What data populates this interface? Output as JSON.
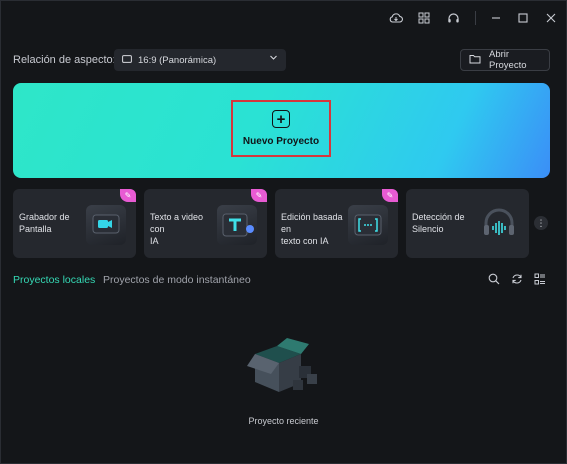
{
  "titlebar": {
    "icons": [
      "cloud-icon",
      "grid-icon",
      "headset-icon",
      "minimize-icon",
      "maximize-icon",
      "close-icon"
    ]
  },
  "aspect": {
    "label": "Relación de aspecto:",
    "selected": "16:9 (Panorámica)"
  },
  "open_project": {
    "label": "Abrir Proyecto"
  },
  "banner": {
    "new_project_label": "Nuevo Proyecto",
    "colors": {
      "start": "#2ee6c8",
      "end": "#3b8ef7"
    }
  },
  "tools": [
    {
      "line1": "Grabador de",
      "line2": "Pantalla",
      "icon": "screen-recorder-icon"
    },
    {
      "line1": "Texto a video con",
      "line2": "IA",
      "icon": "text-to-video-icon"
    },
    {
      "line1": "Edición basada en",
      "line2": "texto con IA",
      "icon": "text-edit-icon"
    },
    {
      "line1": "Detección de",
      "line2": "Silencio",
      "icon": "silence-detect-icon"
    }
  ],
  "tabs": {
    "local": "Proyectos locales",
    "instant": "Proyectos de modo instantáneo"
  },
  "empty": {
    "label": "Proyecto reciente"
  },
  "accent": "#35d9b5"
}
